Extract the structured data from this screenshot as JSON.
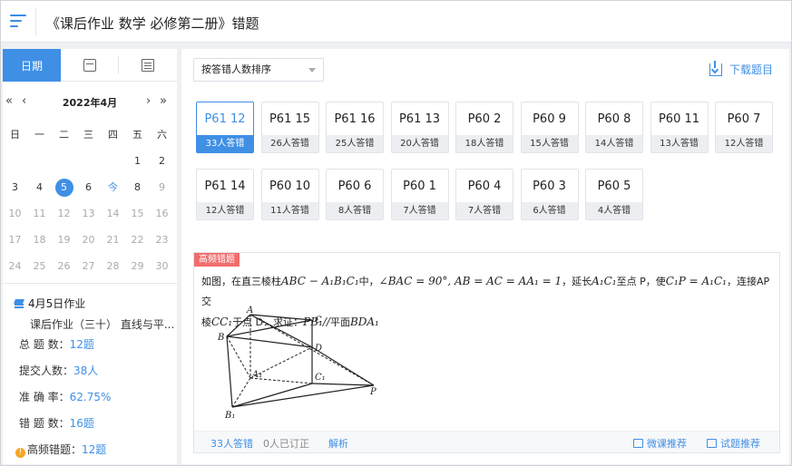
{
  "header": {
    "title": "《课后作业 数学 必修第二册》错题"
  },
  "sidebar": {
    "tabs": [
      {
        "label": "日期"
      }
    ],
    "calendar": {
      "month": "2022年4月",
      "weekdays": [
        "日",
        "一",
        "二",
        "三",
        "四",
        "五",
        "六"
      ],
      "rows": [
        [
          "",
          "",
          "",
          "",
          "",
          "1",
          "2"
        ],
        [
          "3",
          "4",
          "5",
          "6",
          "今",
          "8",
          "9"
        ],
        [
          "10",
          "11",
          "12",
          "13",
          "14",
          "15",
          "16"
        ],
        [
          "17",
          "18",
          "19",
          "20",
          "21",
          "22",
          "23"
        ],
        [
          "24",
          "25",
          "26",
          "27",
          "28",
          "29",
          "30"
        ]
      ],
      "selected": "5",
      "today_label": "今"
    },
    "homework": {
      "title": "4月5日作业",
      "subtitle": "课后作业（三十） 直线与平...",
      "stats": [
        {
          "label": "总 题 数：",
          "value": "12题"
        },
        {
          "label": "提交人数：",
          "value": "38人"
        },
        {
          "label": "准 确 率：",
          "value": "62.75%"
        },
        {
          "label": "错 题 数：",
          "value": "16题"
        }
      ],
      "high_freq": {
        "label": "高频错题：",
        "value": "12题"
      }
    }
  },
  "toolbar": {
    "sort_label": "按答错人数排序",
    "download_label": "下载题目"
  },
  "question_cards": [
    {
      "label": "P61 12",
      "count": "33人答错",
      "active": true
    },
    {
      "label": "P61 15",
      "count": "26人答错"
    },
    {
      "label": "P61 16",
      "count": "25人答错"
    },
    {
      "label": "P61 13",
      "count": "20人答错"
    },
    {
      "label": "P60 2",
      "count": "18人答错"
    },
    {
      "label": "P60 9",
      "count": "15人答错"
    },
    {
      "label": "P60 8",
      "count": "14人答错"
    },
    {
      "label": "P60 11",
      "count": "13人答错"
    },
    {
      "label": "P60 7",
      "count": "12人答错"
    },
    {
      "label": "P61 14",
      "count": "12人答错"
    },
    {
      "label": "P60 10",
      "count": "11人答错"
    },
    {
      "label": "P60 6",
      "count": "8人答错"
    },
    {
      "label": "P60 1",
      "count": "7人答错"
    },
    {
      "label": "P60 4",
      "count": "7人答错"
    },
    {
      "label": "P60 3",
      "count": "6人答错"
    },
    {
      "label": "P60 5",
      "count": "4人答错"
    }
  ],
  "question": {
    "tag": "高频错题",
    "line1_a": "如图，在直三棱柱",
    "line1_m1": "ABC − A₁B₁C₁",
    "line1_b": "中，",
    "line1_m2": "∠BAC = 90°, AB = AC = AA₁ = 1",
    "line1_c": "，延长",
    "line1_m3": "A₁C₁",
    "line1_d": "至点 P，使",
    "line1_m4": "C₁P = A₁C₁",
    "line1_e": "，连接AP交",
    "line2_a": "棱",
    "line2_m1": "CC₁",
    "line2_b": "于点 D．求证：",
    "line2_m2": "PB₁//",
    "line2_c": "平面",
    "line2_m3": "BDA₁",
    "figure_labels": {
      "A": "A",
      "B": "B",
      "C": "C",
      "D": "D",
      "A1": "A₁",
      "B1": "B₁",
      "C1": "C₁",
      "P": "P"
    },
    "footer": {
      "wrong": "33人答错",
      "corrected": "0人已订正",
      "analysis": "解析",
      "video": "微课推荐",
      "recommend": "试题推荐"
    }
  }
}
